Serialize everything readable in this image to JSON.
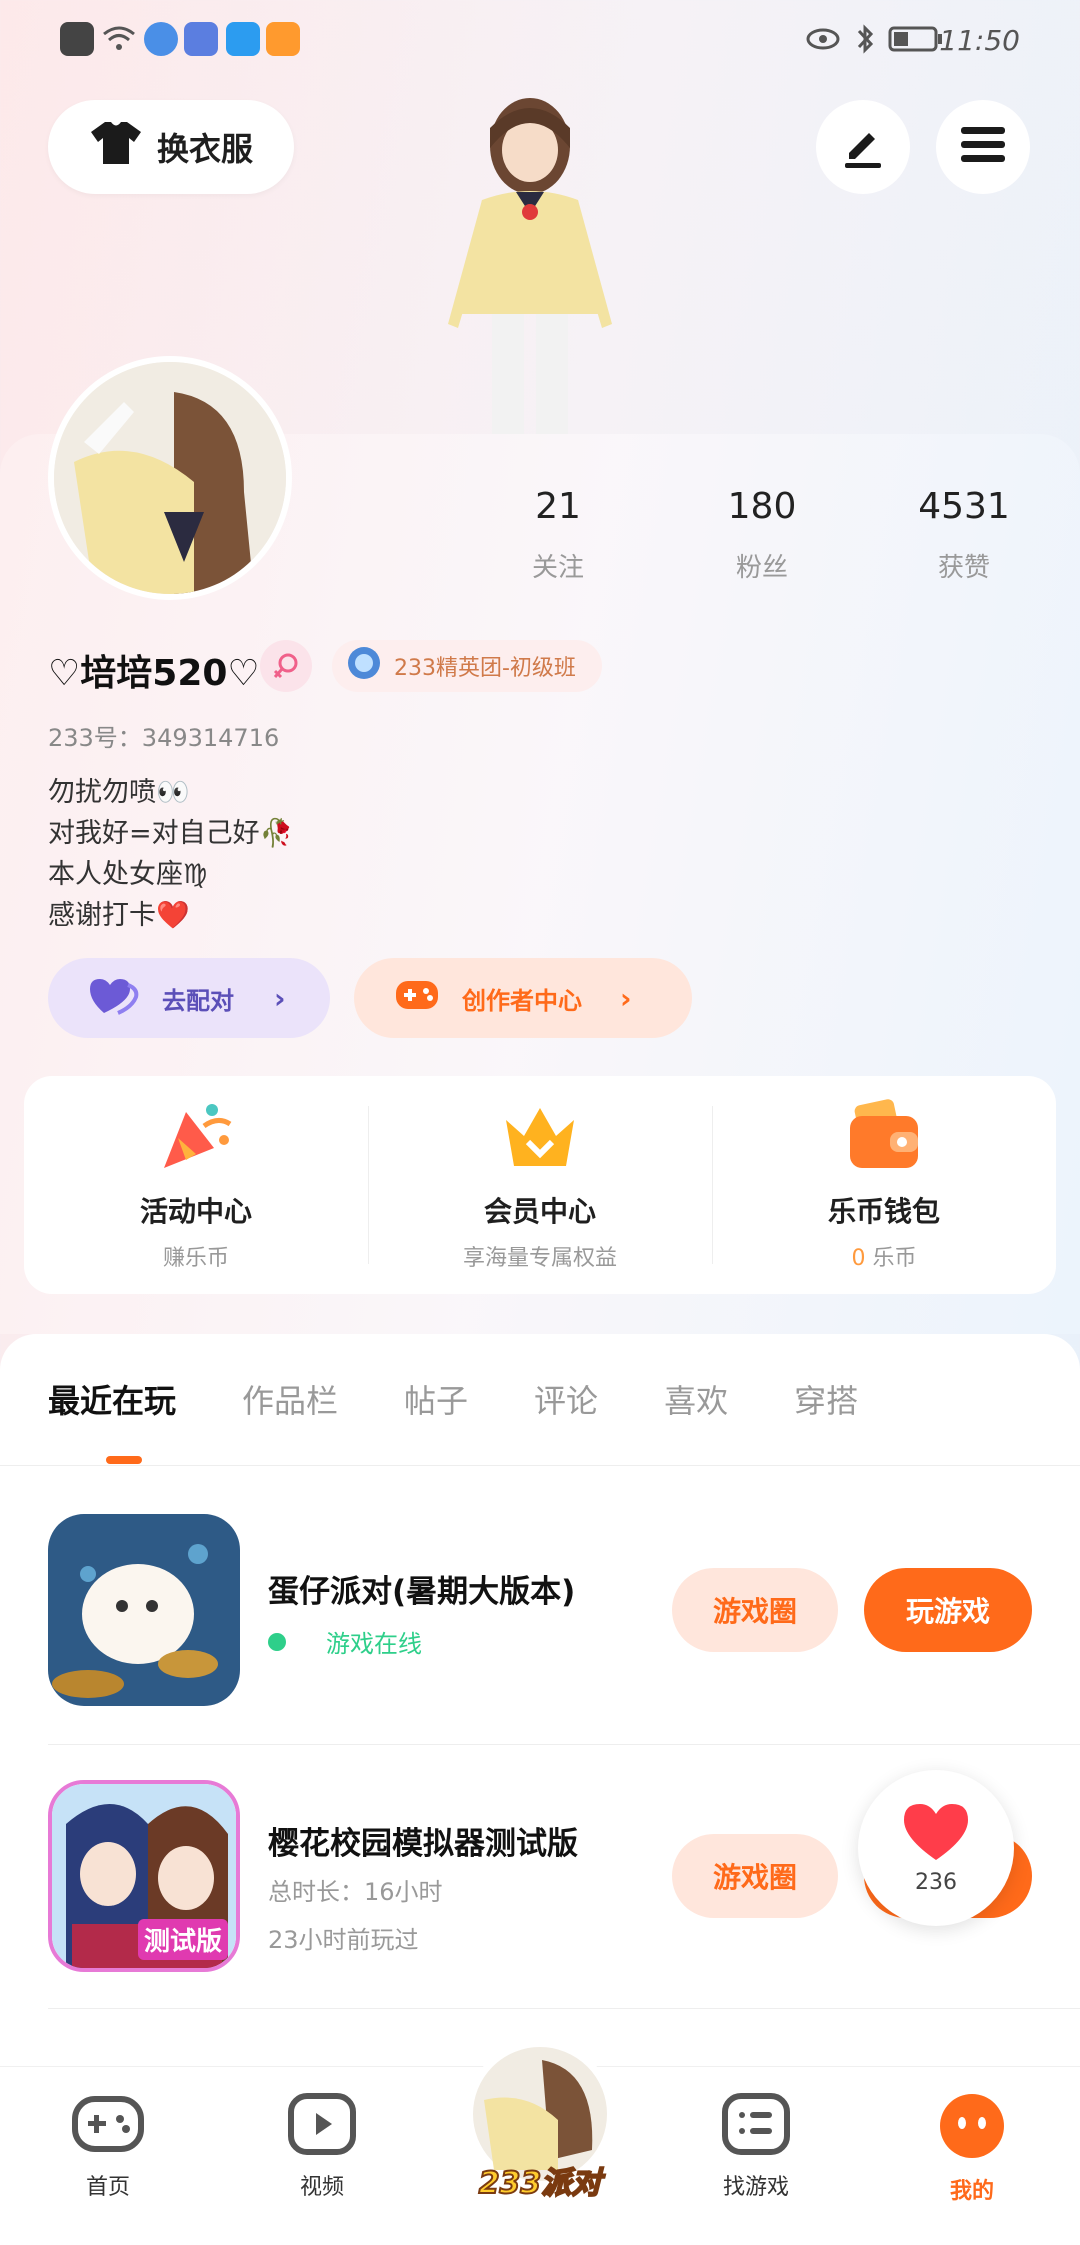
{
  "status_bar": {
    "time": "11:50"
  },
  "header": {
    "dress_up_label": "换衣服"
  },
  "profile": {
    "stats": [
      {
        "value": "21",
        "label": "关注"
      },
      {
        "value": "180",
        "label": "粉丝"
      },
      {
        "value": "4531",
        "label": "获赞"
      }
    ],
    "name": "♡培培520♡",
    "badge_text": "233精英团-初级班",
    "uid": "233号：349314716",
    "bio": [
      "勿扰勿喷👀",
      "对我好=对自己好🥀",
      "本人处女座♍",
      "感谢打卡❤️"
    ],
    "actions": {
      "pair": "去配对",
      "creator": "创作者中心"
    }
  },
  "services": [
    {
      "title": "活动中心",
      "subtitle": "赚乐币"
    },
    {
      "title": "会员中心",
      "subtitle": "享海量专属权益"
    },
    {
      "title": "乐币钱包",
      "subtitle_value": "0",
      "subtitle": "乐币"
    }
  ],
  "tabs": [
    "最近在玩",
    "作品栏",
    "帖子",
    "评论",
    "喜欢",
    "穿搭"
  ],
  "games": [
    {
      "name": "蛋仔派对(暑期大版本)",
      "status": "游戏在线",
      "circle_label": "游戏圈",
      "play_label": "玩游戏"
    },
    {
      "name": "樱花校园模拟器测试版",
      "duration": "总时长：16小时",
      "last_played": "23小时前玩过",
      "circle_label": "游戏圈",
      "icon_text": "测试版"
    }
  ],
  "like": {
    "count": "236"
  },
  "nav": {
    "home": "首页",
    "video": "视频",
    "center": "233派对",
    "find": "找游戏",
    "mine": "我的"
  },
  "colors": {
    "accent": "#ff6a1a",
    "pair_bg": "#ebe3fa",
    "creator_bg": "#ffe6dc",
    "online": "#2ecf8a"
  }
}
